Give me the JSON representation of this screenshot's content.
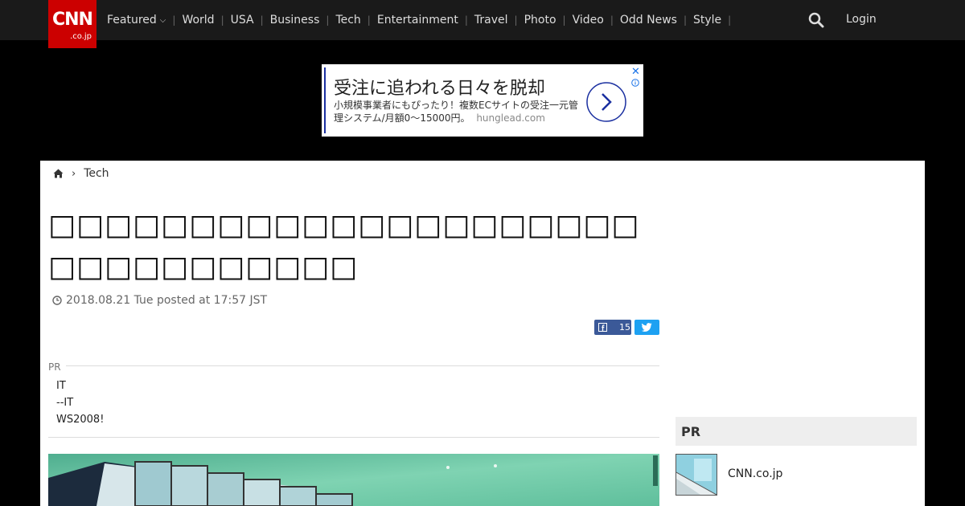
{
  "header": {
    "logo_text": "CNN",
    "logo_sub": ".co.jp",
    "nav": [
      "Featured",
      "World",
      "USA",
      "Business",
      "Tech",
      "Entertainment",
      "Travel",
      "Photo",
      "Video",
      "Odd News",
      "Style"
    ],
    "login": "Login",
    "colors": {
      "bar": "#1a1a1a",
      "logo": "#cc0000"
    }
  },
  "ad": {
    "headline": "受注に追われる日々を脱却",
    "body": "小規模事業者にもぴったり！複数ECサイトの受注一元管理システム/月額0〜15000円。",
    "domain": "hunglead.com",
    "close": "✕"
  },
  "breadcrumb": {
    "section": "Tech"
  },
  "article": {
    "title": "□□□□□□□□□□□□□□□□□□□□□□□□□□□□□□□□",
    "date": "2018.08.21 Tue posted at 17:57 JST",
    "share_count": "15"
  },
  "pr_block": {
    "label": "PR",
    "links": [
      "IT",
      "--IT",
      "WS2008!"
    ]
  },
  "sidebar": {
    "pr_title": "PR",
    "item_label": "CNN.co.jp"
  }
}
